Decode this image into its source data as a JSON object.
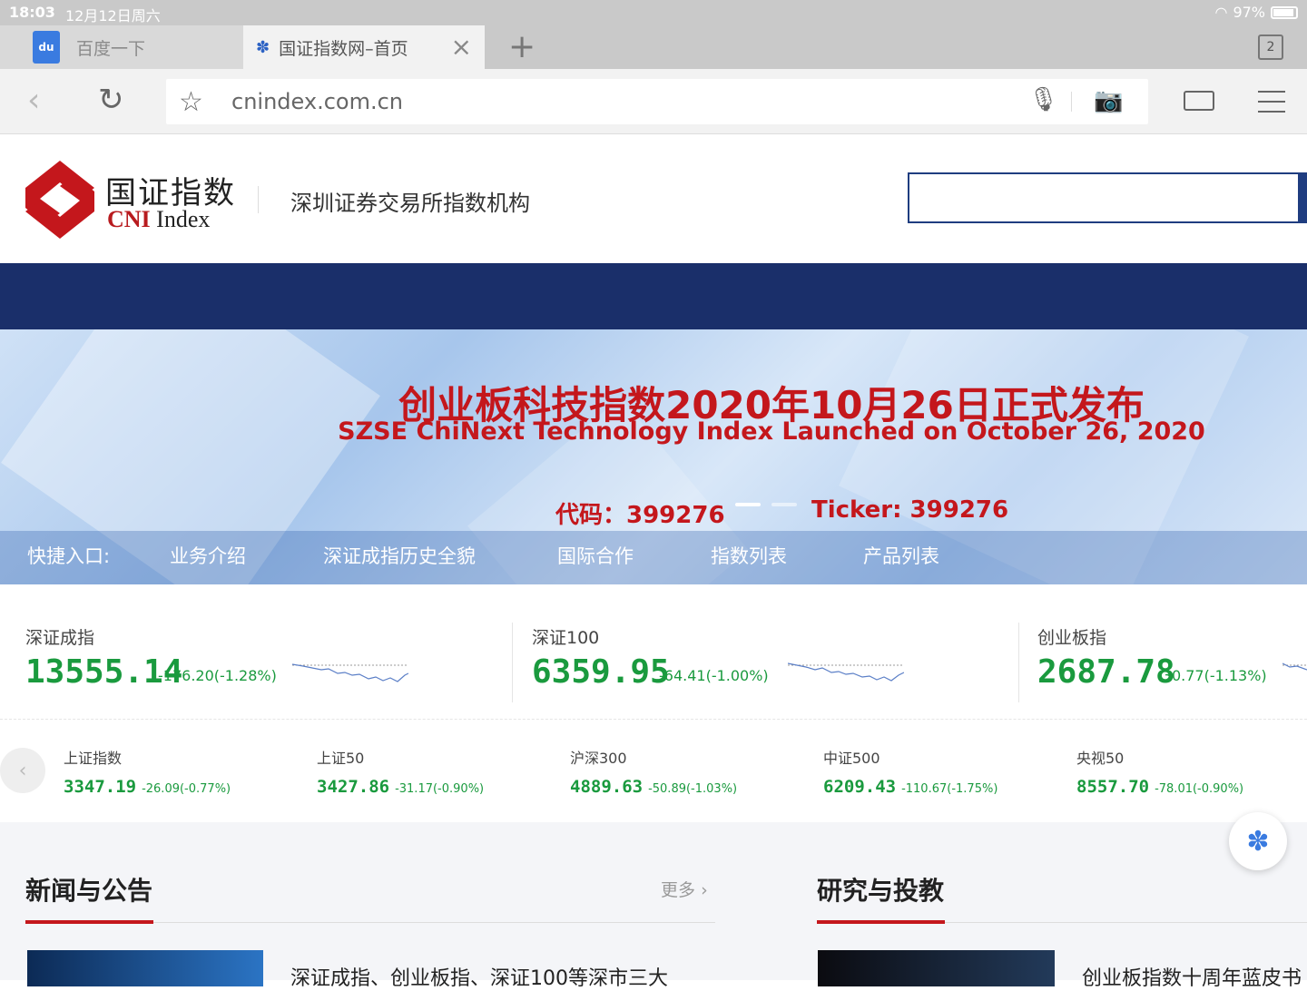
{
  "status_bar": {
    "time": "18:03",
    "date": "12月12日周六",
    "battery": "97%"
  },
  "tabs": [
    {
      "label": "百度一下",
      "active": false
    },
    {
      "label": "国证指数网–首页",
      "active": true
    }
  ],
  "tab_count": "2",
  "address_bar": {
    "url": "cnindex.com.cn"
  },
  "site": {
    "logo_cn": "国证指数",
    "logo_en_strong": "CNI",
    "logo_en_rest": " Index",
    "slogan": "深圳证券交易所指数机构"
  },
  "banner": {
    "title_cn": "创业板科技指数2020年10月26日正式发布",
    "title_en": "SZSE ChiNext Technology Index Launched on October 26, 2020",
    "code_cn": "代码：399276",
    "code_en": "Ticker: 399276"
  },
  "quick_links": {
    "label": "快捷入口:",
    "items": [
      "业务介绍",
      "深证成指历史全貌",
      "国际合作",
      "指数列表",
      "产品列表"
    ]
  },
  "main_indices": [
    {
      "name": "深证成指",
      "value": "13555.14",
      "change": "-176.20(-1.28%)"
    },
    {
      "name": "深证100",
      "value": "6359.95",
      "change": "-64.41(-1.00%)"
    },
    {
      "name": "创业板指",
      "value": "2687.78",
      "change": "-30.77(-1.13%)"
    }
  ],
  "secondary_indices": [
    {
      "name": "上证指数",
      "value": "3347.19",
      "change": "-26.09(-0.77%)"
    },
    {
      "name": "上证50",
      "value": "3427.86",
      "change": "-31.17(-0.90%)"
    },
    {
      "name": "沪深300",
      "value": "4889.63",
      "change": "-50.89(-1.03%)"
    },
    {
      "name": "中证500",
      "value": "6209.43",
      "change": "-110.67(-1.75%)"
    },
    {
      "name": "央视50",
      "value": "8557.70",
      "change": "-78.01(-0.90%)"
    }
  ],
  "news": {
    "title": "新闻与公告",
    "more": "更多",
    "first_item": "深证成指、创业板指、深证100等深市三大"
  },
  "research": {
    "title": "研究与投教",
    "first_item": "创业板指数十周年蓝皮书"
  },
  "colors": {
    "brand_red": "#c4171c",
    "navy": "#1a2f6a",
    "down_green": "#1a9a3e"
  }
}
